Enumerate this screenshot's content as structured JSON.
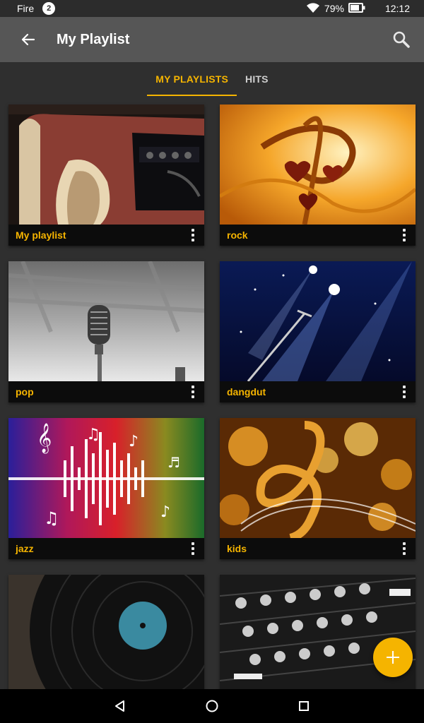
{
  "status_bar": {
    "carrier": "Fire",
    "notification_count": "2",
    "battery": "79%",
    "time": "12:12"
  },
  "app_bar": {
    "title": "My Playlist"
  },
  "tabs": [
    {
      "label": "MY PLAYLISTS",
      "active": true
    },
    {
      "label": "HITS",
      "active": false
    }
  ],
  "playlists": [
    {
      "label": "My playlist",
      "image": "guitar-amp"
    },
    {
      "label": "rock",
      "image": "treble-clef-hearts"
    },
    {
      "label": "pop",
      "image": "vintage-microphone"
    },
    {
      "label": "dangdut",
      "image": "stage-spotlights"
    },
    {
      "label": "jazz",
      "image": "music-notes-waveform"
    },
    {
      "label": "kids",
      "image": "golden-clef-bokeh"
    },
    {
      "label": "",
      "image": "vinyl-record"
    },
    {
      "label": "",
      "image": "dj-mixer"
    }
  ],
  "colors": {
    "accent": "#f5b400",
    "app_bar": "#565656",
    "background": "#2f2f2f"
  }
}
